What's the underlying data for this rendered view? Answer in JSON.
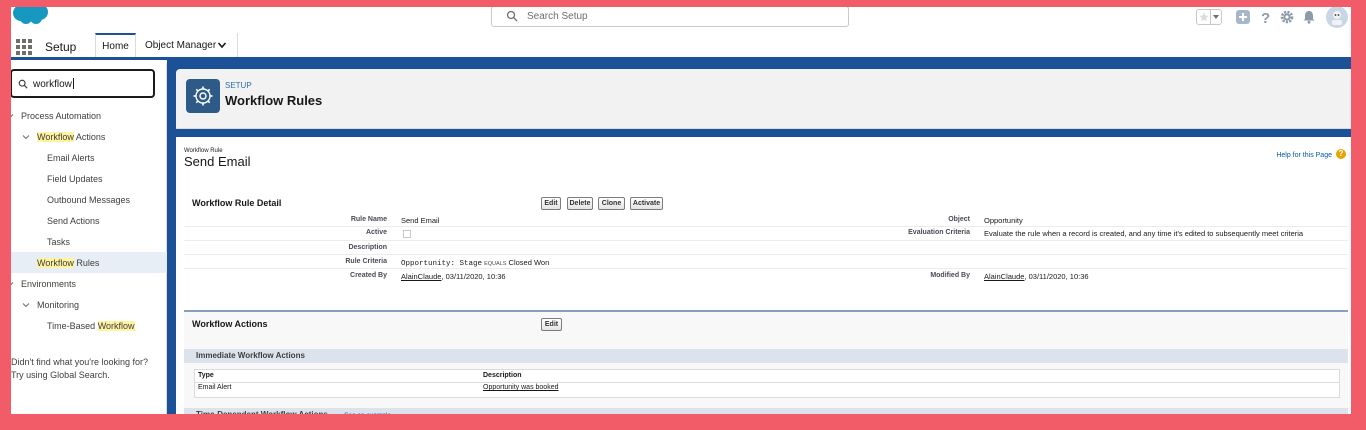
{
  "header": {
    "search_placeholder": "Search Setup",
    "icons": [
      "favorites-star-icon",
      "favorites-dropdown-icon",
      "global-actions-plus-icon",
      "help-icon",
      "setup-gear-icon",
      "notifications-bell-icon",
      "user-avatar"
    ]
  },
  "nav": {
    "app_name": "Setup",
    "tabs": [
      {
        "label": "Home"
      },
      {
        "label": "Object Manager"
      }
    ]
  },
  "sidebar": {
    "quick_find_value": "workflow",
    "tree": [
      {
        "label_pre": "",
        "label_hl": "",
        "label_post": "Process Automation"
      },
      {
        "label_pre": "",
        "label_hl": "Workflow",
        "label_post": " Actions"
      },
      {
        "label_pre": "",
        "label_hl": "",
        "label_post": "Email Alerts"
      },
      {
        "label_pre": "",
        "label_hl": "",
        "label_post": "Field Updates"
      },
      {
        "label_pre": "",
        "label_hl": "",
        "label_post": "Outbound Messages"
      },
      {
        "label_pre": "",
        "label_hl": "",
        "label_post": "Send Actions"
      },
      {
        "label_pre": "",
        "label_hl": "",
        "label_post": "Tasks"
      },
      {
        "label_pre": "",
        "label_hl": "Workflow",
        "label_post": " Rules"
      },
      {
        "label_pre": "",
        "label_hl": "",
        "label_post": "Environments"
      },
      {
        "label_pre": "",
        "label_hl": "",
        "label_post": "Monitoring"
      },
      {
        "label_pre": "Time-Based ",
        "label_hl": "Workflow",
        "label_post": ""
      }
    ],
    "help_line1": "Didn't find what you're looking for?",
    "help_line2": "Try using Global Search."
  },
  "page_header": {
    "eyebrow": "SETUP",
    "title": "Workflow Rules"
  },
  "record": {
    "type_label": "Workflow Rule",
    "name": "Send Email",
    "help_link": "Help for this Page",
    "help_icon": "?"
  },
  "detail": {
    "title": "Workflow Rule Detail",
    "buttons": {
      "edit": "Edit",
      "delete": "Delete",
      "clone": "Clone",
      "activate": "Activate"
    },
    "fields": {
      "rule_name_label": "Rule Name",
      "rule_name": "Send Email",
      "object_label": "Object",
      "object": "Opportunity",
      "active_label": "Active",
      "active": false,
      "eval_label": "Evaluation Criteria",
      "eval": "Evaluate the rule when a record is created, and any time it's edited to subsequently meet criteria",
      "description_label": "Description",
      "criteria_label": "Rule Criteria",
      "criteria_field": "Opportunity: Stage",
      "criteria_operator": "EQUALS",
      "criteria_value": "Closed Won",
      "created_by_label": "Created By",
      "created_by_user": "AlainClaude",
      "created_by_date": ", 03/11/2020, 10:36",
      "modified_by_label": "Modified By",
      "modified_by_user": "AlainClaude",
      "modified_by_date": ", 03/11/2020, 10:36"
    }
  },
  "actions": {
    "title": "Workflow Actions",
    "edit_button": "Edit",
    "immediate_title": "Immediate Workflow Actions",
    "columns": {
      "type": "Type",
      "description": "Description"
    },
    "rows": [
      {
        "type": "Email Alert",
        "description": "Opportunity was booked"
      }
    ],
    "time_dependent_title": "Time-Dependent Workflow Actions",
    "see_example": "See an example"
  }
}
